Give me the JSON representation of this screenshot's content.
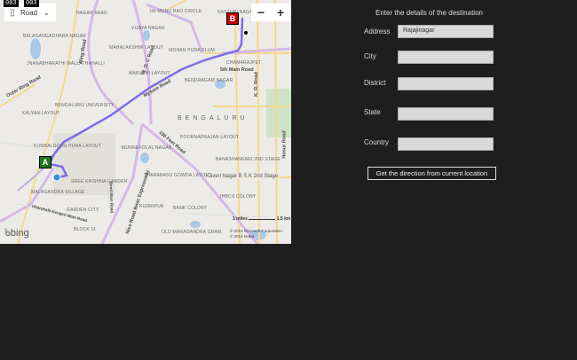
{
  "debug": {
    "left": "003",
    "right": "003"
  },
  "map": {
    "style_select": "Road",
    "zoom_out": "−",
    "zoom_in": "+",
    "marker_start": "A",
    "marker_end": "B",
    "places": [
      "Nagar Baad",
      "Jai Munu Rao Circle",
      "Kasturi Nagar",
      "Vijaya Nagar",
      "Balagangadhara Nagar",
      "Mahalakshmi Layout",
      "Mohan Pura Slum",
      "Jnanabharathi Mallathahalli",
      "Maruthi Layout",
      "Bendragam Nagar",
      "Bengaluru University",
      "Kalyan Layout",
      "Kumbalgodu Pura Layout",
      "Munnekolal Nagar",
      "Poornaprajan Layout",
      "Banashankari 2nd Stage",
      "Tharabasu Gowda Layout",
      "Kaveri Nagar B S K 2nd Stage",
      "Sree Krishna Garden",
      "Malagandra Village",
      "Garden City",
      "JHBCS Colony",
      "Kudripur",
      "Bank Colony",
      "Block 11",
      "Old Maragandra Gram",
      "Bengaluru",
      "Chamarajpet"
    ],
    "roads": [
      "Ring Road",
      "W. O. C Road",
      "Mysore Road",
      "100 Feet Road",
      "Nice Road Bmic Expressway",
      "5th Main Road",
      "K. R. Road",
      "Outer Ring Road",
      "Uttarahalli Kengeri Main Road",
      "Bend Main Road",
      "Hosur Road"
    ],
    "scale": "1 miles",
    "scale_km": "1.5 km",
    "brand": "bing",
    "copyright1": "© 2014 Microsoft Corporation",
    "copyright2": "© 2014 Nokia"
  },
  "form": {
    "title": "Enter the details of the destination",
    "fields": [
      {
        "label": "Address",
        "value": "Rajajinagar"
      },
      {
        "label": "City",
        "value": ""
      },
      {
        "label": "District",
        "value": ""
      },
      {
        "label": "State",
        "value": ""
      },
      {
        "label": "Country",
        "value": ""
      }
    ],
    "button": "Get the direction from current location"
  },
  "colors": {
    "route": "#7b6ee6",
    "background": "#1e1e1e",
    "start": "#1e7a1e",
    "end": "#c00000"
  }
}
